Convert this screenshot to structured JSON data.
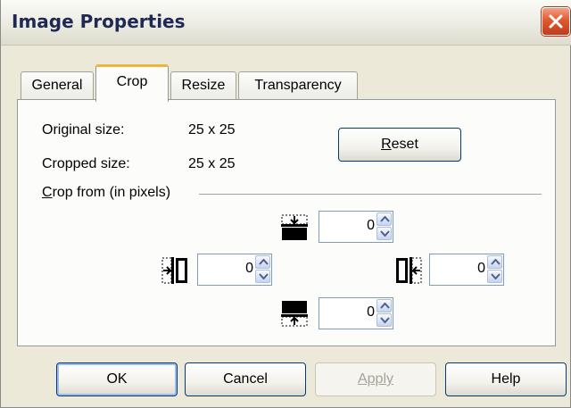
{
  "dialog": {
    "title": "Image Properties"
  },
  "tabs": [
    {
      "label": "General",
      "active": false
    },
    {
      "label": "Crop",
      "active": true
    },
    {
      "label": "Resize",
      "active": false
    },
    {
      "label": "Transparency",
      "active": false
    }
  ],
  "crop": {
    "original_size_label": "Original size:",
    "original_size_value": "25 x 25",
    "cropped_size_label": "Cropped size:",
    "cropped_size_value": "25 x 25",
    "reset_label_accel": "R",
    "reset_label_rest": "eset",
    "section_label_accel": "C",
    "section_label_rest": "rop from (in pixels)",
    "top_value": "0",
    "left_value": "0",
    "right_value": "0",
    "bottom_value": "0"
  },
  "footer": {
    "ok_label": "OK",
    "cancel_label": "Cancel",
    "apply_label": "Apply",
    "apply_enabled": false,
    "help_label": "Help"
  },
  "icons": [
    "close-icon",
    "crop-top-icon",
    "crop-left-icon",
    "crop-right-icon",
    "crop-bottom-icon",
    "spin-up-icon",
    "spin-down-icon"
  ],
  "colors": {
    "dialog_bg": "#ece9d8",
    "panel_bg": "#fcfcfb",
    "active_tab_accent": "#f0b33c",
    "close_button": "#dd5a32",
    "title_text": "#1e2a55"
  }
}
